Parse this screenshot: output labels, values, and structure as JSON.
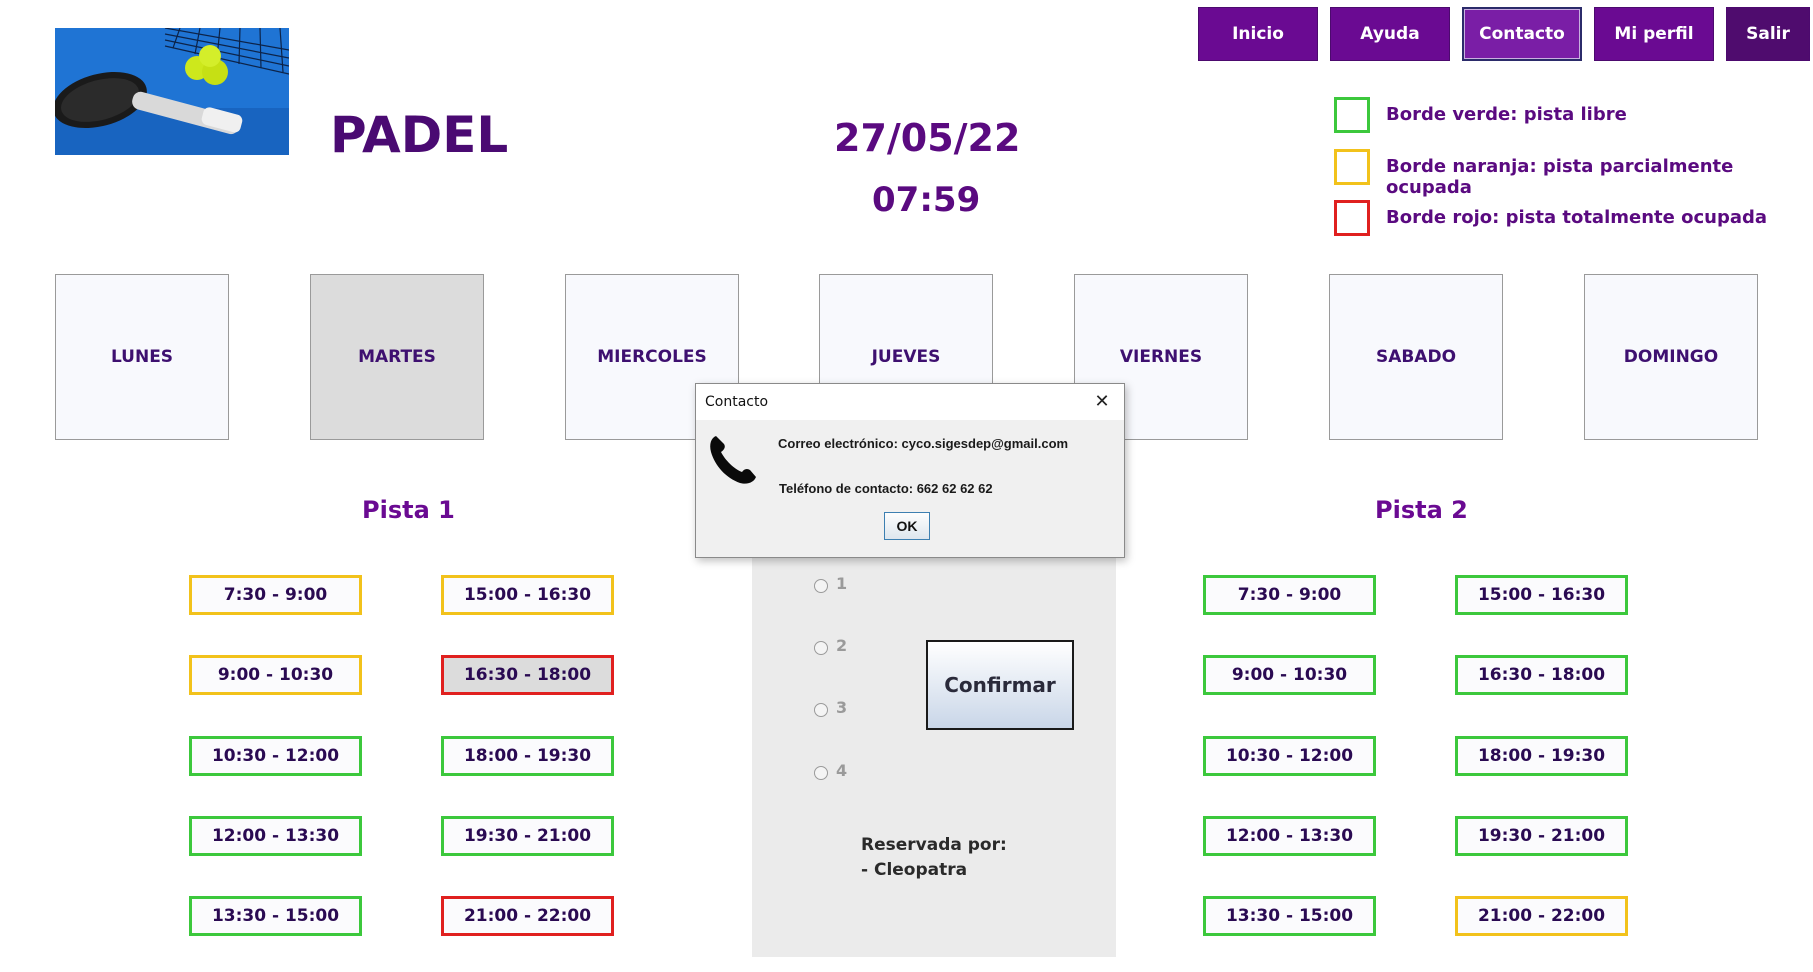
{
  "header": {
    "title": "PADEL",
    "date": "27/05/22",
    "time": "07:59",
    "logo_icon": "padel-racket-photo"
  },
  "nav": {
    "inicio": "Inicio",
    "ayuda": "Ayuda",
    "contacto": "Contacto",
    "perfil": "Mi perfil",
    "salir": "Salir"
  },
  "legend": [
    {
      "label": "Borde verde: pista libre",
      "color": "#3cc83c"
    },
    {
      "label": "Borde naranja: pista parcialmente ocupada",
      "color": "#f2c21b"
    },
    {
      "label": "Borde rojo: pista totalmente ocupada",
      "color": "#e0201f"
    }
  ],
  "days": [
    "LUNES",
    "MARTES",
    "MIERCOLES",
    "JUEVES",
    "VIERNES",
    "SABADO",
    "DOMINGO"
  ],
  "selected_day": "MARTES",
  "pista1": {
    "label": "Pista 1",
    "col1": [
      {
        "time": "7:30 - 9:00",
        "status": "orange"
      },
      {
        "time": "9:00 - 10:30",
        "status": "orange"
      },
      {
        "time": "10:30 - 12:00",
        "status": "green"
      },
      {
        "time": "12:00 - 13:30",
        "status": "green"
      },
      {
        "time": "13:30 - 15:00",
        "status": "green"
      }
    ],
    "col2": [
      {
        "time": "15:00 - 16:30",
        "status": "orange"
      },
      {
        "time": "16:30 - 18:00",
        "status": "red",
        "selected": true
      },
      {
        "time": "18:00 - 19:30",
        "status": "green"
      },
      {
        "time": "19:30 - 21:00",
        "status": "green"
      },
      {
        "time": "21:00 - 22:00",
        "status": "red"
      }
    ]
  },
  "pista2": {
    "label": "Pista 2",
    "col1": [
      {
        "time": "7:30 - 9:00",
        "status": "green"
      },
      {
        "time": "9:00 - 10:30",
        "status": "green"
      },
      {
        "time": "10:30 - 12:00",
        "status": "green"
      },
      {
        "time": "12:00 - 13:30",
        "status": "green"
      },
      {
        "time": "13:30 - 15:00",
        "status": "green"
      }
    ],
    "col2": [
      {
        "time": "15:00 - 16:30",
        "status": "green"
      },
      {
        "time": "16:30 - 18:00",
        "status": "green"
      },
      {
        "time": "18:00 - 19:30",
        "status": "green"
      },
      {
        "time": "19:30 - 21:00",
        "status": "green"
      },
      {
        "time": "21:00 - 22:00",
        "status": "orange"
      }
    ]
  },
  "panel": {
    "options": [
      "1",
      "2",
      "3",
      "4"
    ],
    "confirm_label": "Confirmar",
    "reserved_title": "Reservada por:",
    "reserved_by": "- Cleopatra"
  },
  "dialog": {
    "title": "Contacto",
    "close_glyph": "✕",
    "email_line": "Correo electrónico: cyco.sigesdep@gmail.com",
    "phone_line": "Teléfono de contacto: 662 62 62 62",
    "ok_label": "OK",
    "icon": "phone-icon"
  }
}
